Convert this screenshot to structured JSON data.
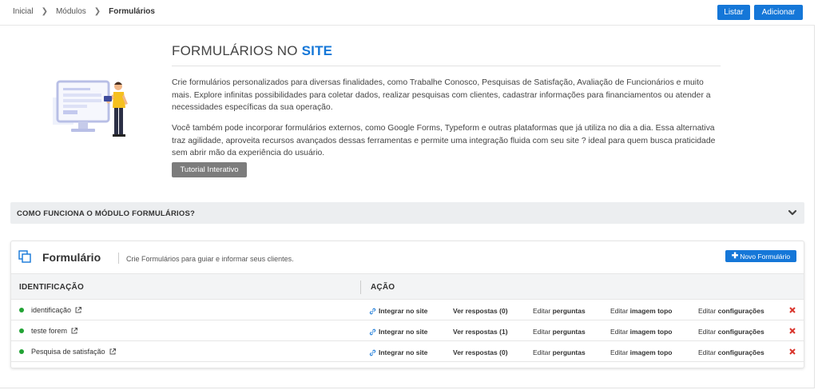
{
  "breadcrumb": {
    "items": [
      "Inicial",
      "Módulos"
    ],
    "current": "Formulários"
  },
  "header_actions": {
    "list_label": "Listar",
    "add_label": "Adicionar"
  },
  "hero": {
    "title_prefix": "FORMULÁRIOS NO",
    "title_accent": "SITE",
    "paragraph1": "Crie formulários personalizados para diversas finalidades, como Trabalhe Conosco, Pesquisas de Satisfação, Avaliação de Funcionários e muito mais. Explore infinitas possibilidades para coletar dados, realizar pesquisas com clientes, cadastrar informações para financiamentos ou atender a necessidades específicas da sua operação.",
    "paragraph2": "Você também pode incorporar formulários externos, como Google Forms, Typeform e outras plataformas que já utiliza no dia a dia. Essa alternativa traz agilidade, aproveita recursos avançados dessas ferramentas e permite uma integração fluida com seu site ? ideal para quem busca praticidade sem abrir mão da experiência do usuário.",
    "tutorial_label": "Tutorial Interativo"
  },
  "accordion": {
    "label": "COMO FUNCIONA O MÓDULO FORMULÁRIOS?",
    "icon": "chevron-down-icon"
  },
  "card": {
    "title": "Formulário",
    "subtitle": "Crie Formulários para guiar e informar seus clientes.",
    "new_button_label": "Novo Formulário",
    "columns": {
      "identification": "IDENTIFICAÇÃO",
      "action": "AÇÃO"
    },
    "action_labels": {
      "integrate": "Integrar no site",
      "view_prefix": "Ver respostas",
      "edit_prefix": "Editar",
      "questions": "perguntas",
      "image": "imagem topo",
      "settings": "configurações"
    },
    "rows": [
      {
        "name": "identificação",
        "responses": "(0)",
        "status_color": "#22a335"
      },
      {
        "name": "teste forem",
        "responses": "(1)",
        "status_color": "#22a335"
      },
      {
        "name": "Pesquisa de satisfação",
        "responses": "(0)",
        "status_color": "#22a335"
      }
    ]
  },
  "colors": {
    "primary": "#1577d8",
    "danger": "#d9342b",
    "active": "#22a335",
    "tutorial": "#7c7c7c"
  }
}
